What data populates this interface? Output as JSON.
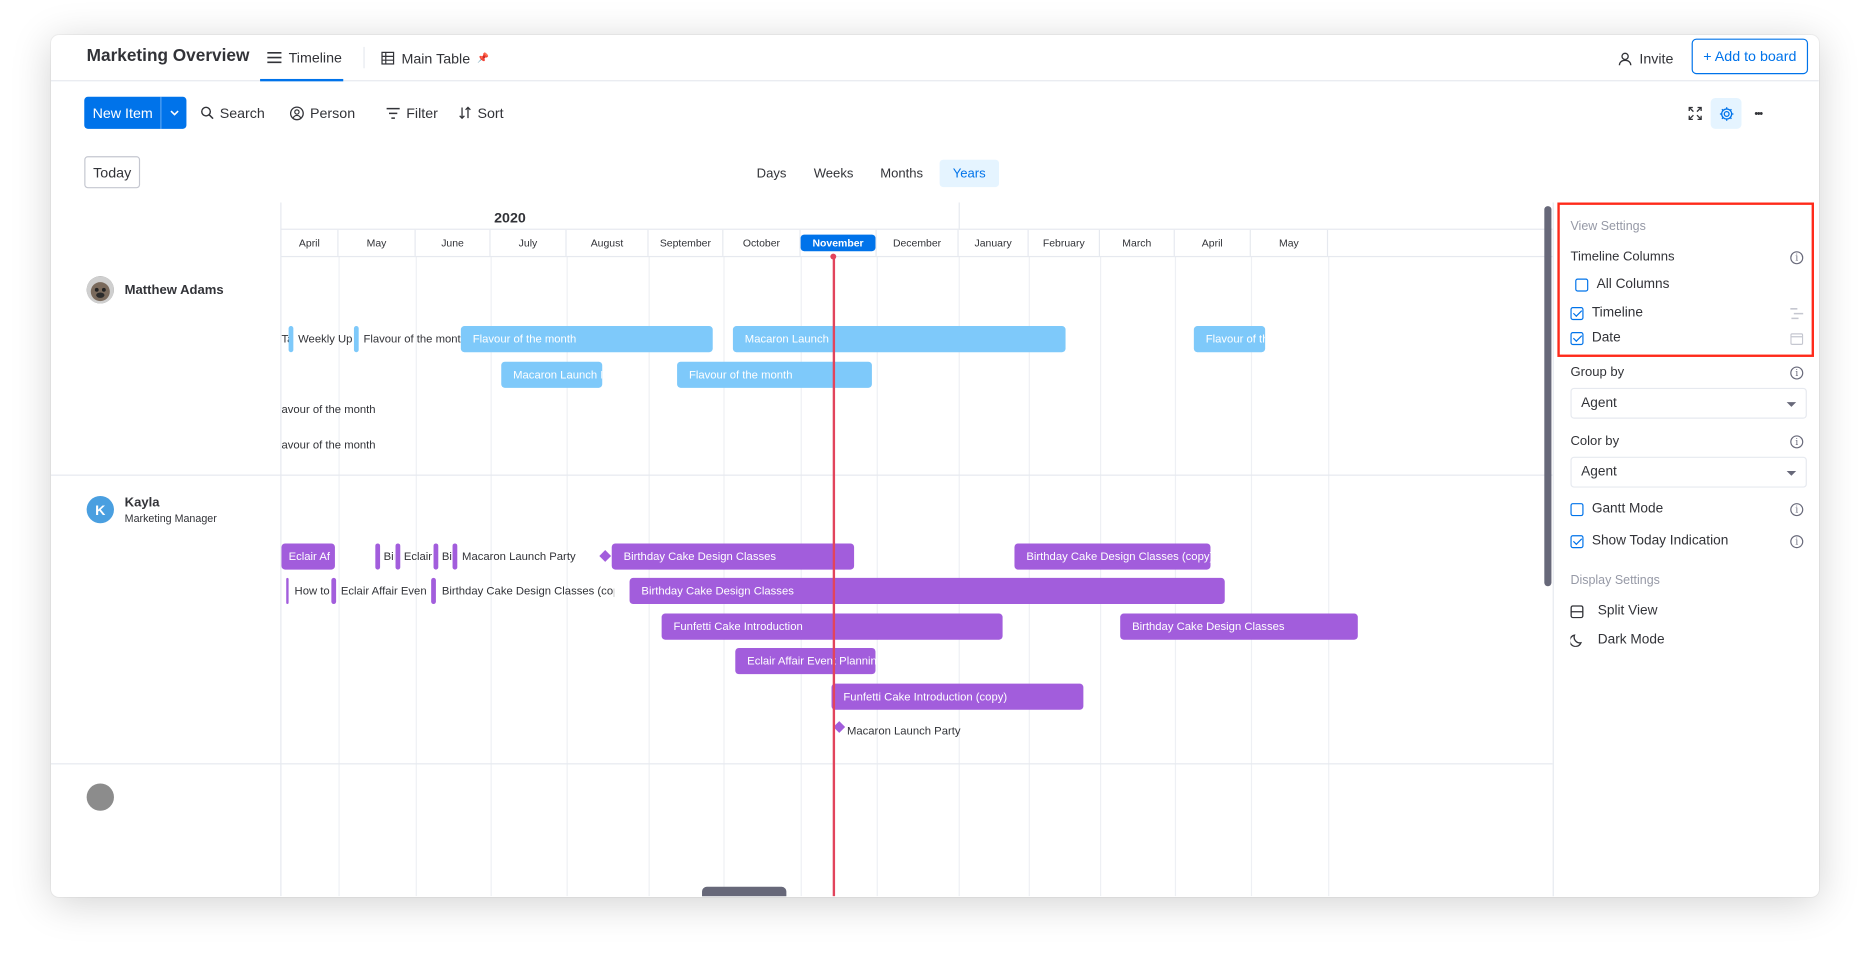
{
  "header": {
    "board_title": "Marketing Overview",
    "tabs": [
      {
        "label": "Timeline",
        "active": true
      },
      {
        "label": "Main Table",
        "active": false,
        "pin": "📌"
      }
    ],
    "invite_label": "Invite",
    "add_to_board_label": "+ Add to board"
  },
  "toolbar": {
    "new_item_label": "New Item",
    "search_label": "Search",
    "person_label": "Person",
    "filter_label": "Filter",
    "sort_label": "Sort",
    "more_glyph": "•••"
  },
  "timeline_controls": {
    "today_label": "Today",
    "zoom_options": [
      "Days",
      "Weeks",
      "Months",
      "Years"
    ],
    "zoom_selected": "Years"
  },
  "timeline": {
    "year": "2020",
    "months": [
      "April",
      "May",
      "June",
      "July",
      "August",
      "September",
      "October",
      "November",
      "December",
      "January",
      "February",
      "March",
      "April",
      "May"
    ],
    "current_month": "November",
    "groups": [
      {
        "name": "Matthew Adams",
        "role": "",
        "avatar": "photo",
        "items": [
          {
            "label": "Ta",
            "kind": "outside"
          },
          {
            "label": "Weekly Upd",
            "kind": "outside"
          },
          {
            "label": "Flavour of the month",
            "kind": "outside"
          },
          {
            "label": "Flavour of the month",
            "kind": "bar"
          },
          {
            "label": "Macaron Launch",
            "kind": "bar"
          },
          {
            "label": "Flavour of the",
            "kind": "bar"
          },
          {
            "label": "Macaron Launch Pa",
            "kind": "bar"
          },
          {
            "label": "Flavour of the month",
            "kind": "bar"
          },
          {
            "label": "avour of the month",
            "kind": "outside"
          },
          {
            "label": "avour of the month",
            "kind": "outside"
          }
        ]
      },
      {
        "name": "Kayla",
        "role": "Marketing Manager",
        "avatar": "K",
        "avatar_color": "#4a9fe0",
        "items": [
          {
            "label": "Eclair Af",
            "kind": "bar"
          },
          {
            "label": "Bir",
            "kind": "outside"
          },
          {
            "label": "Eclair",
            "kind": "outside"
          },
          {
            "label": "Bir",
            "kind": "outside"
          },
          {
            "label": "Macaron Launch Party",
            "kind": "outside"
          },
          {
            "label": "Birthday Cake Design Classes",
            "kind": "bar"
          },
          {
            "label": "Birthday Cake Design Classes (copy)",
            "kind": "bar"
          },
          {
            "label": "How to",
            "kind": "outside"
          },
          {
            "label": "Eclair Affair Event",
            "kind": "outside"
          },
          {
            "label": "Birthday Cake Design Classes (copy)",
            "kind": "outside"
          },
          {
            "label": "Birthday Cake Design Classes",
            "kind": "bar"
          },
          {
            "label": "Funfetti Cake Introduction",
            "kind": "bar"
          },
          {
            "label": "Birthday Cake Design Classes",
            "kind": "bar"
          },
          {
            "label": "Eclair Affair Event Planning",
            "kind": "bar"
          },
          {
            "label": "Funfetti Cake Introduction (copy)",
            "kind": "bar"
          },
          {
            "label": "Macaron Launch Party",
            "kind": "milestone"
          }
        ]
      }
    ]
  },
  "settings": {
    "view_settings_title": "View Settings",
    "timeline_columns_label": "Timeline Columns",
    "all_columns": {
      "label": "All Columns",
      "checked": false
    },
    "columns": [
      {
        "label": "Timeline",
        "checked": true
      },
      {
        "label": "Date",
        "checked": true
      }
    ],
    "group_by_label": "Group by",
    "group_by_value": "Agent",
    "color_by_label": "Color by",
    "color_by_value": "Agent",
    "gantt_mode": {
      "label": "Gantt Mode",
      "checked": false
    },
    "show_today": {
      "label": "Show Today Indication",
      "checked": true
    },
    "display_settings_title": "Display Settings",
    "split_view_label": "Split View",
    "dark_mode_label": "Dark Mode",
    "info_glyph": "i"
  },
  "colors": {
    "accent": "#0073ea",
    "today_line": "#e2445c",
    "group1_bar": "#7ec9fa",
    "group2_bar": "#a25ddc",
    "highlight": "#ff2a1a"
  }
}
